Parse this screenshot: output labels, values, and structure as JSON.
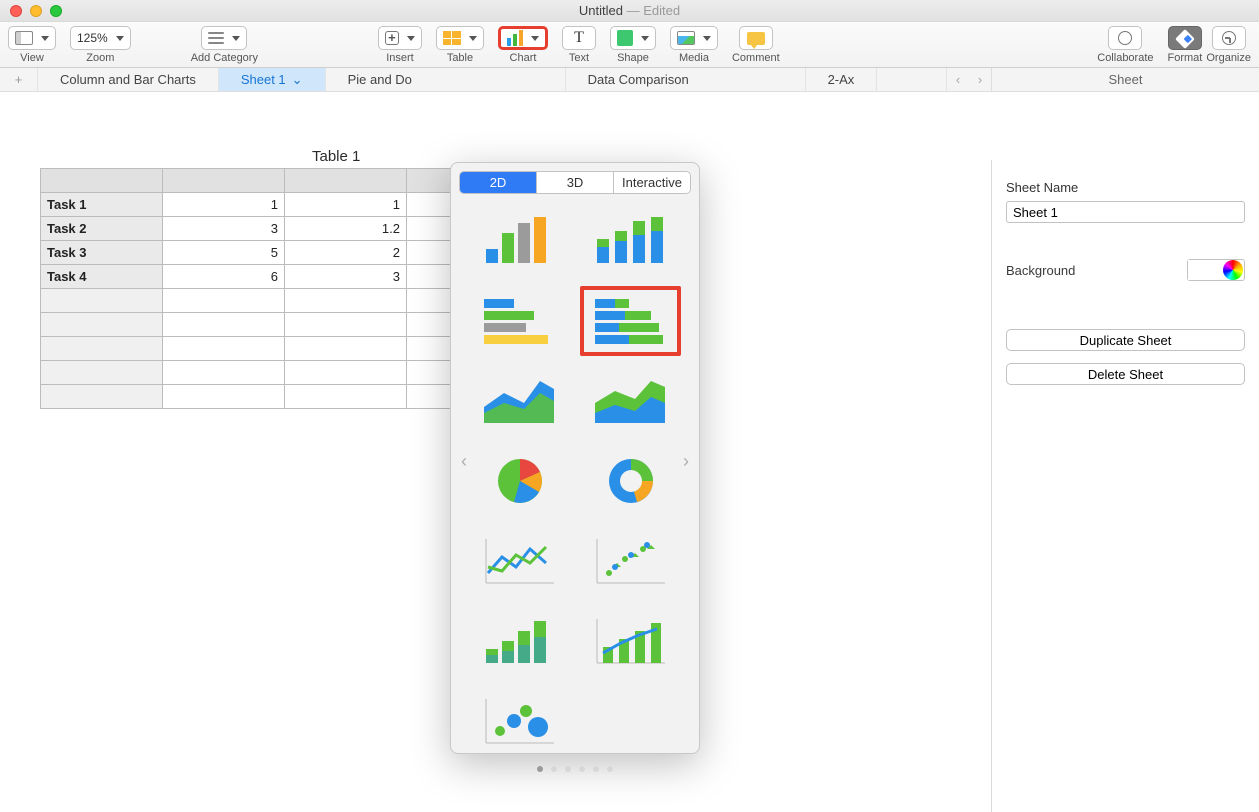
{
  "window": {
    "title": "Untitled",
    "edited": "— Edited"
  },
  "toolbar": {
    "view": "View",
    "zoom_value": "125%",
    "zoom": "Zoom",
    "add_category": "Add Category",
    "insert": "Insert",
    "table": "Table",
    "chart": "Chart",
    "text": "Text",
    "shape": "Shape",
    "media": "Media",
    "comment": "Comment",
    "collaborate": "Collaborate",
    "format": "Format",
    "organize": "Organize"
  },
  "sheet_tabs": {
    "items": [
      "Column and Bar Charts",
      "Sheet 1",
      "Pie and Do",
      "Data Comparison",
      "2-Ax"
    ],
    "active_index": 1
  },
  "table": {
    "title": "Table 1",
    "rows": [
      {
        "label": "Task 1",
        "b": "1",
        "c": "1"
      },
      {
        "label": "Task 2",
        "b": "3",
        "c": "1.2"
      },
      {
        "label": "Task 3",
        "b": "5",
        "c": "2"
      },
      {
        "label": "Task 4",
        "b": "6",
        "c": "3"
      }
    ]
  },
  "popover": {
    "tabs": {
      "d2": "2D",
      "d3": "3D",
      "interactive": "Interactive"
    },
    "chart_types": [
      "clustered-column",
      "stacked-column",
      "clustered-bar",
      "stacked-bar",
      "area",
      "stacked-area",
      "pie",
      "donut",
      "line",
      "scatter",
      "column-3d-look",
      "mixed",
      "bubble",
      ""
    ],
    "selected_index": 3
  },
  "inspector": {
    "tab": "Sheet",
    "sheet_name_label": "Sheet Name",
    "sheet_name_value": "Sheet 1",
    "background_label": "Background",
    "duplicate": "Duplicate Sheet",
    "delete": "Delete Sheet"
  }
}
